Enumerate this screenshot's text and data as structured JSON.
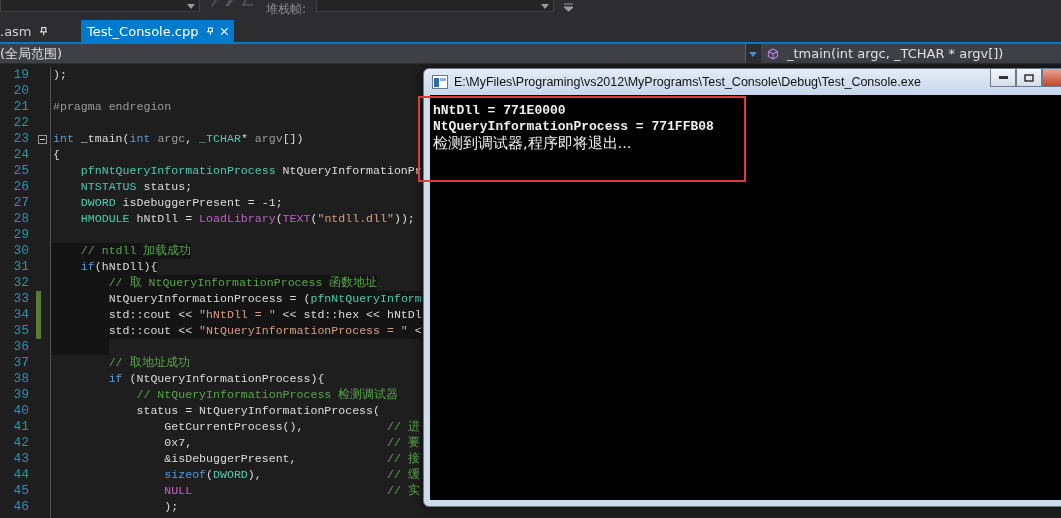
{
  "toolbar": {
    "stack_frame_label": "堆栈帧:"
  },
  "tabs": [
    {
      "label": ".asm",
      "selected": false
    },
    {
      "label": "Test_Console.cpp",
      "selected": true
    }
  ],
  "nav": {
    "scope": "(全局范围)",
    "member": "_tmain(int argc, _TCHAR * argv[])"
  },
  "editor": {
    "lines": [
      {
        "number": "19",
        "segments": [
          {
            "kind": "plain",
            "text": ");"
          }
        ]
      },
      {
        "number": "20"
      },
      {
        "number": "21",
        "segments": [
          {
            "kind": "pragma",
            "text": "#pragma endregion"
          }
        ]
      },
      {
        "number": "22"
      },
      {
        "number": "23",
        "fold_toggle": true,
        "segments": [
          {
            "kind": "keyword",
            "text": "int"
          },
          {
            "kind": "plain",
            "text": " _tmain("
          },
          {
            "kind": "keyword",
            "text": "int"
          },
          {
            "kind": "param",
            "text": " argc"
          },
          {
            "kind": "plain",
            "text": ", "
          },
          {
            "kind": "type",
            "text": "_TCHAR"
          },
          {
            "kind": "plain",
            "text": "* "
          },
          {
            "kind": "param",
            "text": "argv"
          },
          {
            "kind": "plain",
            "text": "[])"
          }
        ]
      },
      {
        "number": "24",
        "segments": [
          {
            "kind": "plain",
            "text": "{"
          }
        ]
      },
      {
        "number": "25",
        "segments": [
          {
            "kind": "type",
            "text": "    pfnNtQueryInformationProcess"
          },
          {
            "kind": "plain",
            "text": " NtQueryInformationPr"
          }
        ]
      },
      {
        "number": "26",
        "segments": [
          {
            "kind": "type",
            "text": "    NTSTATUS"
          },
          {
            "kind": "plain",
            "text": " status;"
          }
        ]
      },
      {
        "number": "27",
        "segments": [
          {
            "kind": "type",
            "text": "    DWORD"
          },
          {
            "kind": "plain",
            "text": " isDebuggerPresent = -1;"
          }
        ]
      },
      {
        "number": "28",
        "segments": [
          {
            "kind": "type",
            "text": "    HMODULE"
          },
          {
            "kind": "plain",
            "text": " hNtDll = "
          },
          {
            "kind": "func",
            "text": "LoadLibrary"
          },
          {
            "kind": "plain",
            "text": "("
          },
          {
            "kind": "func",
            "text": "TEXT"
          },
          {
            "kind": "plain",
            "text": "("
          },
          {
            "kind": "string",
            "text": "\"ntdll.dll\""
          },
          {
            "kind": "plain",
            "text": "));"
          }
        ]
      },
      {
        "number": "29"
      },
      {
        "number": "30",
        "highlight": true,
        "segments": [
          {
            "kind": "comment",
            "text": "    // ntdll 加载成功"
          }
        ]
      },
      {
        "number": "31",
        "highlight": true,
        "segments": [
          {
            "kind": "keyword",
            "text": "    if"
          },
          {
            "kind": "plain",
            "text": "(hNtDll){"
          }
        ]
      },
      {
        "number": "32",
        "highlight": true,
        "segments": [
          {
            "kind": "comment",
            "text": "        // 取 NtQueryInformationProcess 函数地址"
          }
        ]
      },
      {
        "number": "33",
        "highlight": true,
        "changed": true,
        "segments": [
          {
            "kind": "plain",
            "text": "        NtQueryInformationProcess = ("
          },
          {
            "kind": "type",
            "text": "pfnNtQueryInform"
          }
        ]
      },
      {
        "number": "34",
        "highlight": true,
        "changed": true,
        "segments": [
          {
            "kind": "plain",
            "text": "        std::cout << "
          },
          {
            "kind": "string",
            "text": "\"hNtDll = \""
          },
          {
            "kind": "plain",
            "text": " << std::hex << hNtDl"
          }
        ]
      },
      {
        "number": "35",
        "highlight": true,
        "changed": true,
        "segments": [
          {
            "kind": "plain",
            "text": "        std::cout << "
          },
          {
            "kind": "string",
            "text": "\"NtQueryInformationProcess = \""
          },
          {
            "kind": "plain",
            "text": " <"
          }
        ]
      },
      {
        "number": "36",
        "highlight": true
      },
      {
        "number": "37",
        "segments": [
          {
            "kind": "comment",
            "text": "        // 取地址成功"
          }
        ]
      },
      {
        "number": "38",
        "segments": [
          {
            "kind": "keyword",
            "text": "        if"
          },
          {
            "kind": "plain",
            "text": " (NtQueryInformationProcess){"
          }
        ]
      },
      {
        "number": "39",
        "segments": [
          {
            "kind": "comment",
            "text": "            // NtQueryInformationProcess 检测调试器"
          }
        ]
      },
      {
        "number": "40",
        "segments": [
          {
            "kind": "plain",
            "text": "            status = NtQueryInformationProcess("
          }
        ]
      },
      {
        "number": "41",
        "segments": [
          {
            "kind": "plain",
            "text": "                GetCurrentProcess(),            "
          },
          {
            "kind": "comment",
            "text": "// 进"
          }
        ]
      },
      {
        "number": "42",
        "segments": [
          {
            "kind": "plain",
            "text": "                0x7,                            "
          },
          {
            "kind": "comment",
            "text": "// 要"
          }
        ]
      },
      {
        "number": "43",
        "segments": [
          {
            "kind": "plain",
            "text": "                &isDebuggerPresent,             "
          },
          {
            "kind": "comment",
            "text": "// 接"
          }
        ]
      },
      {
        "number": "44",
        "segments": [
          {
            "kind": "keyword",
            "text": "                sizeof"
          },
          {
            "kind": "plain",
            "text": "("
          },
          {
            "kind": "type",
            "text": "DWORD"
          },
          {
            "kind": "plain",
            "text": "),                  "
          },
          {
            "kind": "comment",
            "text": "// 缓"
          }
        ]
      },
      {
        "number": "45",
        "segments": [
          {
            "kind": "func",
            "text": "                NULL"
          },
          {
            "kind": "comment",
            "text": "                            // 实"
          }
        ]
      },
      {
        "number": "46",
        "segments": [
          {
            "kind": "plain",
            "text": "                );"
          }
        ]
      }
    ]
  },
  "console": {
    "title": "E:\\MyFiles\\Programing\\vs2012\\MyPrograms\\Test_Console\\Debug\\Test_Console.exe",
    "lines": [
      {
        "kind": "ascii",
        "text": "hNtDll = 771E0000"
      },
      {
        "kind": "ascii",
        "text": "NtQueryInformationProcess = 771FFB08"
      },
      {
        "kind": "cjk",
        "text": "检测到调试器,程序即将退出..."
      }
    ]
  }
}
